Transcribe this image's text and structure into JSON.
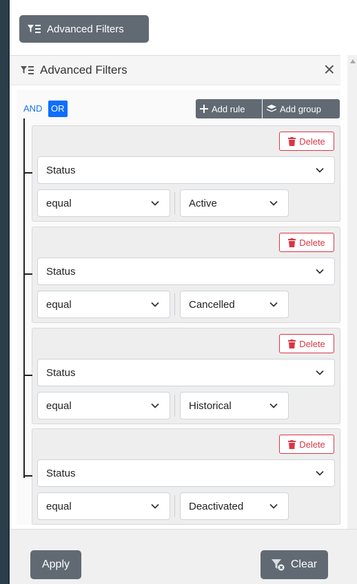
{
  "toolbar": {
    "advanced_filters_button": "Advanced Filters"
  },
  "panel": {
    "title": "Advanced Filters",
    "close_glyph": "×"
  },
  "group": {
    "and_label": "AND",
    "or_label": "OR",
    "selected_condition": "OR",
    "add_rule_label": "Add rule",
    "add_group_label": "Add group"
  },
  "rules": [
    {
      "delete_label": "Delete",
      "field": "Status",
      "operator": "equal",
      "value": "Active"
    },
    {
      "delete_label": "Delete",
      "field": "Status",
      "operator": "equal",
      "value": "Cancelled"
    },
    {
      "delete_label": "Delete",
      "field": "Status",
      "operator": "equal",
      "value": "Historical"
    },
    {
      "delete_label": "Delete",
      "field": "Status",
      "operator": "equal",
      "value": "Deactivated"
    }
  ],
  "footer": {
    "apply_label": "Apply",
    "clear_label": "Clear"
  },
  "colors": {
    "button_gray": "#616a73",
    "primary_blue": "#0d6efd",
    "danger_red": "#dc3545"
  },
  "icons": {
    "filter": "filter-icon",
    "close": "close-icon",
    "plus": "plus-icon",
    "layers": "layers-icon",
    "trash": "trash-icon",
    "chevron": "chevron-down-icon",
    "filter_clear": "filter-clear-icon"
  }
}
